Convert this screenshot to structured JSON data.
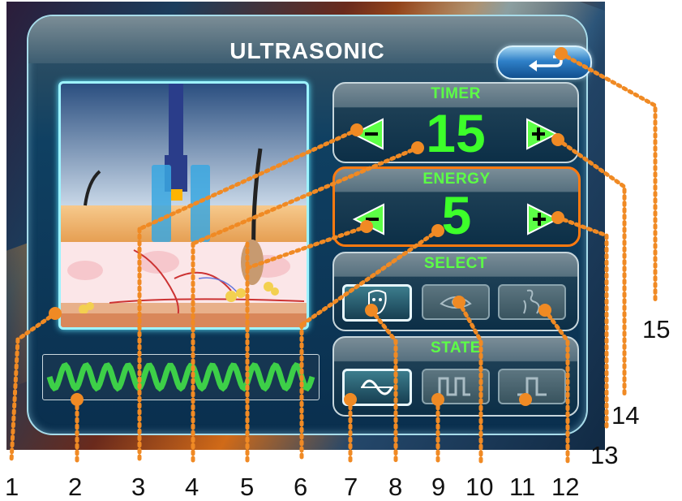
{
  "screen": {
    "title": "ULTRASONIC",
    "back_icon": "return-arrow-icon"
  },
  "timer": {
    "label": "TIMER",
    "value": "15",
    "decrease_icon": "minus-arrow-icon",
    "increase_icon": "plus-arrow-icon"
  },
  "energy": {
    "label": "ENERGY",
    "value": "5",
    "decrease_icon": "minus-arrow-icon",
    "increase_icon": "plus-arrow-icon"
  },
  "select": {
    "label": "SELECT",
    "options": [
      {
        "icon": "face-icon",
        "active": true
      },
      {
        "icon": "eye-icon",
        "active": false
      },
      {
        "icon": "body-icon",
        "active": false
      }
    ]
  },
  "state": {
    "label": "STATE",
    "options": [
      {
        "icon": "sine-wave-icon",
        "active": true
      },
      {
        "icon": "pulse-train-icon",
        "active": false
      },
      {
        "icon": "single-pulse-icon",
        "active": false
      }
    ]
  },
  "callouts": [
    "1",
    "2",
    "3",
    "4",
    "5",
    "6",
    "7",
    "8",
    "9",
    "10",
    "11",
    "12",
    "13",
    "14",
    "15"
  ],
  "colors": {
    "accent_green": "#3dff2a",
    "callout_orange": "#f08a24",
    "energy_border": "#ff7a10"
  }
}
